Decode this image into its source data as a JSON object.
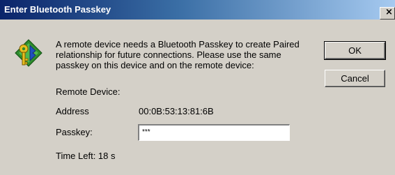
{
  "window": {
    "title": "Enter Bluetooth Passkey",
    "close_glyph": "×"
  },
  "icons": {
    "dialog_icon": "key-icon"
  },
  "message": "A remote device needs a Bluetooth Passkey to create Paired relationship for future connections. Please use the same passkey on this device and on the remote device:",
  "buttons": {
    "ok": "OK",
    "cancel": "Cancel"
  },
  "fields": {
    "remote_device_label": "Remote Device:",
    "address_label": "Address",
    "address_value": "00:0B:53:13:81:6B",
    "passkey_label": "Passkey:",
    "passkey_value": "***",
    "time_left": "Time Left: 18 s"
  }
}
